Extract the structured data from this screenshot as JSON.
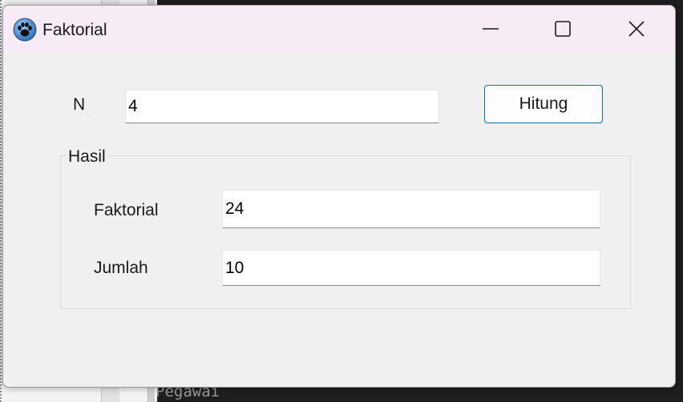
{
  "window": {
    "title": "Faktorial",
    "icon": "paw-icon",
    "controls": [
      "minimize-icon",
      "maximize-icon",
      "close-icon"
    ]
  },
  "form": {
    "n_label": "N",
    "n_value": "4",
    "calc_button": "Hitung"
  },
  "result": {
    "group_title": "Hasil",
    "factorial_label": "Faktorial",
    "factorial_value": "24",
    "sum_label": "Jumlah",
    "sum_value": "10"
  },
  "background": {
    "code_text": "Pegawai"
  },
  "colors": {
    "titlebar": "#f7ecf6",
    "window": "#f0f0f0",
    "accent": "#0f6cbd"
  }
}
